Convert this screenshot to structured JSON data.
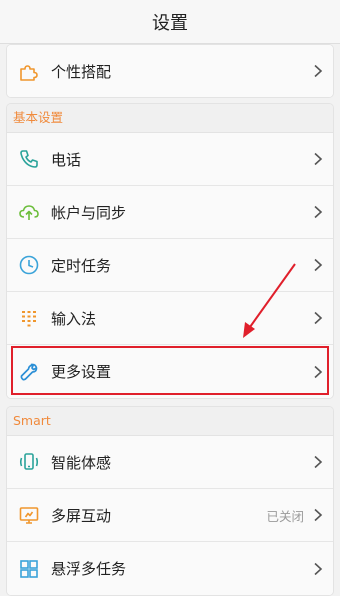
{
  "header": {
    "title": "设置"
  },
  "top_item": {
    "label": "个性搭配",
    "icon": "puzzle-icon"
  },
  "sections": [
    {
      "title": "基本设置",
      "items": [
        {
          "label": "电话",
          "icon": "phone-icon"
        },
        {
          "label": "帐户与同步",
          "icon": "cloud-sync-icon"
        },
        {
          "label": "定时任务",
          "icon": "clock-icon"
        },
        {
          "label": "输入法",
          "icon": "keypad-icon"
        },
        {
          "label": "更多设置",
          "icon": "wrench-icon"
        }
      ]
    },
    {
      "title": "Smart",
      "items": [
        {
          "label": "智能体感",
          "icon": "gesture-phone-icon"
        },
        {
          "label": "多屏互动",
          "icon": "multiscreen-icon",
          "status": "已关闭"
        },
        {
          "label": "悬浮多任务",
          "icon": "floating-window-icon"
        }
      ]
    }
  ],
  "colors": {
    "section_title": "#f08a3c",
    "icon_teal": "#2aa39a",
    "icon_green": "#6bbd3a",
    "icon_blue": "#3aa3d9",
    "icon_orange": "#f0962c",
    "annotation_red": "#e01f2b"
  }
}
